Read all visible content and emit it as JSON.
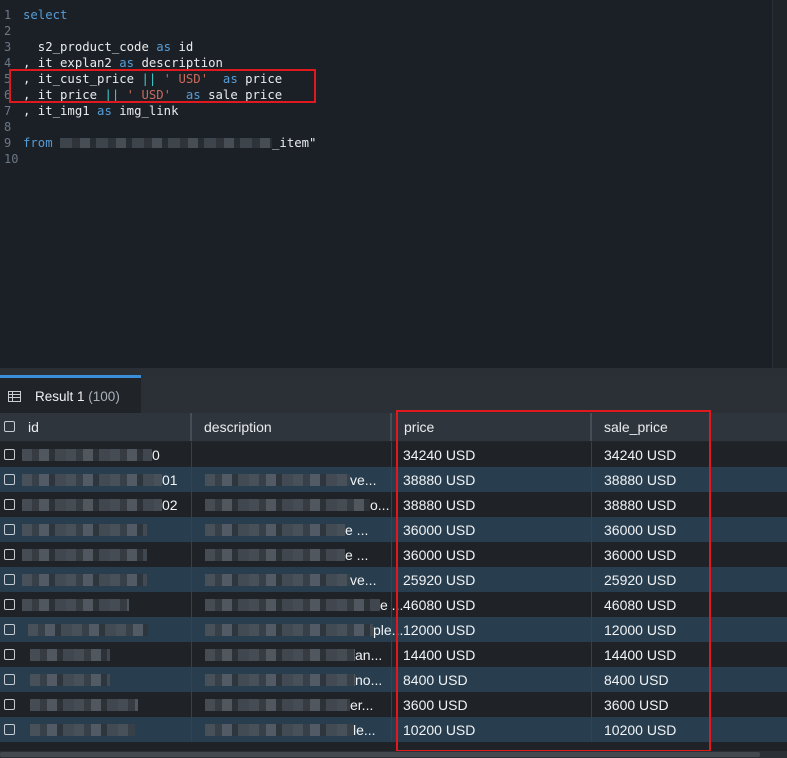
{
  "editor": {
    "line_numbers": [
      "1",
      "2",
      "3",
      "4",
      "5",
      "6",
      "7",
      "8",
      "9",
      "10"
    ],
    "lines": {
      "l1": {
        "kw": "select"
      },
      "l3": {
        "expr": "  s2_product_code ",
        "kw": "as",
        "alias": " id"
      },
      "l4": {
        "expr": ", it_explan2 ",
        "kw": "as",
        "alias": " description"
      },
      "l5": {
        "expr": ", it_cust_price ",
        "op": "||",
        "str": " ' USD' ",
        "kw": " as",
        "alias": " price"
      },
      "l6": {
        "expr": ", it_price ",
        "op": "||",
        "str": " ' USD' ",
        "kw": " as",
        "alias": " sale_price"
      },
      "l7": {
        "expr": ", it_img1 ",
        "kw": "as",
        "alias": " img_link"
      },
      "l9": {
        "kw": "from",
        "table_suffix": "_item\""
      }
    }
  },
  "results": {
    "tab_label": "Result 1",
    "tab_count": "(100)",
    "columns": [
      "id",
      "description",
      "price",
      "sale_price"
    ],
    "rows": [
      {
        "id_tail": "0",
        "desc_tail": "",
        "price": "34240 USD",
        "sale_price": "34240 USD"
      },
      {
        "id_tail": "01",
        "desc_tail": "ve...",
        "price": "38880 USD",
        "sale_price": "38880 USD"
      },
      {
        "id_tail": "02",
        "desc_tail": "o...",
        "price": "38880 USD",
        "sale_price": "38880 USD"
      },
      {
        "id_tail": "",
        "desc_tail": "e ...",
        "price": "36000 USD",
        "sale_price": "36000 USD"
      },
      {
        "id_tail": "",
        "desc_tail": "e ...",
        "price": "36000 USD",
        "sale_price": "36000 USD"
      },
      {
        "id_tail": "",
        "desc_tail": "ve...",
        "price": "25920 USD",
        "sale_price": "25920 USD"
      },
      {
        "id_tail": "",
        "desc_tail": "e ...",
        "price": "46080 USD",
        "sale_price": "46080 USD"
      },
      {
        "id_tail": "",
        "desc_tail": "ple...",
        "price": "12000 USD",
        "sale_price": "12000 USD"
      },
      {
        "id_tail": "",
        "desc_tail": "an...",
        "price": "14400 USD",
        "sale_price": "14400 USD"
      },
      {
        "id_tail": "",
        "desc_tail": "no...",
        "price": "8400 USD",
        "sale_price": "8400 USD"
      },
      {
        "id_tail": "",
        "desc_tail": "er...",
        "price": "3600 USD",
        "sale_price": "3600 USD"
      },
      {
        "id_tail": "",
        "desc_tail": "le...",
        "price": "10200 USD",
        "sale_price": "10200 USD"
      }
    ]
  },
  "colors": {
    "highlight": "#e0191f",
    "keyword": "#569cd6",
    "string": "#c86a5c",
    "operator": "#3ec9c9",
    "row_alt": "#283d4e"
  }
}
